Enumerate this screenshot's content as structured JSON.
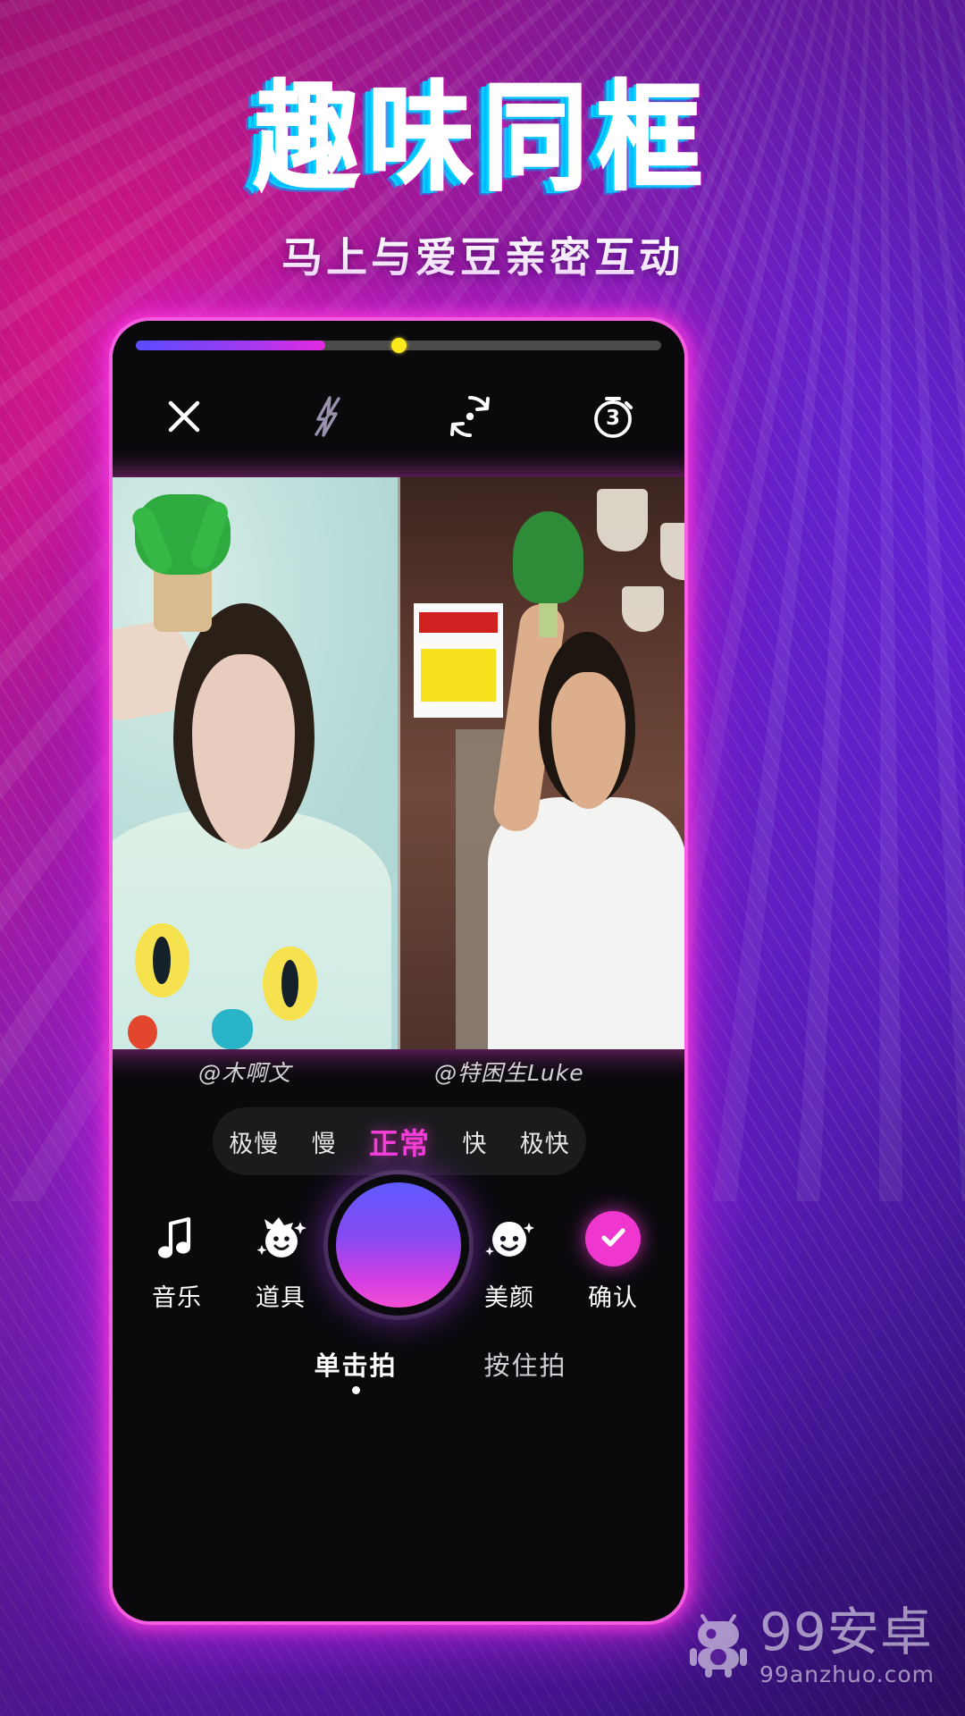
{
  "poster": {
    "headline": "趣味同框",
    "subline": "马上与爱豆亲密互动"
  },
  "phone": {
    "progress": {
      "fill_percent": 36,
      "marker_percent": 50,
      "track_color": "#4a4a4a",
      "fill_color_start": "#5b4bff",
      "fill_color_end": "#e32ae0",
      "marker_color": "#ffe81c"
    },
    "toolbar": [
      {
        "name": "close",
        "icon": "close-icon",
        "label": ""
      },
      {
        "name": "flash",
        "icon": "flash-off-icon",
        "label": ""
      },
      {
        "name": "flip",
        "icon": "camera-flip-icon",
        "label": ""
      },
      {
        "name": "timer",
        "icon": "timer-icon",
        "label": "3"
      }
    ],
    "timer_value": "3",
    "handles": {
      "left": "@木啊文",
      "right": "@特困生Luke"
    },
    "speeds": [
      {
        "label": "极慢",
        "active": false
      },
      {
        "label": "慢",
        "active": false
      },
      {
        "label": "正常",
        "active": true
      },
      {
        "label": "快",
        "active": false
      },
      {
        "label": "极快",
        "active": false
      }
    ],
    "actions": [
      {
        "label": "音乐",
        "icon": "music-note-icon"
      },
      {
        "label": "道具",
        "icon": "props-sticker-icon"
      },
      {
        "label": "美颜",
        "icon": "beauty-face-icon"
      },
      {
        "label": "确认",
        "icon": "check-icon"
      }
    ],
    "shutter": {
      "label": "",
      "gradient_start": "#5f5bff",
      "gradient_end": "#f34fd4"
    },
    "modes": [
      {
        "label": "单击拍",
        "active": true
      },
      {
        "label": "按住拍",
        "active": false
      }
    ],
    "accent_color": "#f43ed6",
    "confirm_color": "#ef36cf"
  },
  "watermark": {
    "title": "99安卓",
    "domain": "99anzhuo.com"
  }
}
